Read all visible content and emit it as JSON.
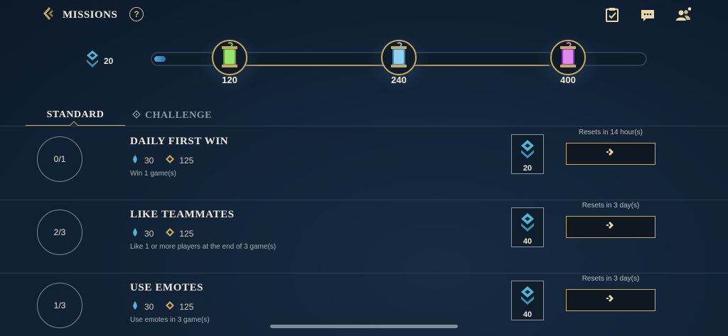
{
  "header": {
    "title": "MISSIONS",
    "help_label": "?",
    "icons": [
      "back-icon",
      "help-icon",
      "clipboard-check-icon",
      "chat-icon",
      "friends-icon"
    ]
  },
  "progress": {
    "current_points": "20",
    "fill_fraction": 0.02,
    "milestones": [
      {
        "label": "120",
        "icon": "green-capsule-icon"
      },
      {
        "label": "240",
        "icon": "blue-capsule-icon"
      },
      {
        "label": "400",
        "icon": "purple-capsule-icon"
      }
    ]
  },
  "tabs": [
    {
      "label": "STANDARD",
      "active": true
    },
    {
      "label": "CHALLENGE",
      "active": false
    }
  ],
  "missions": [
    {
      "progress": "0/1",
      "title": "DAILY FIRST WIN",
      "blue_reward": "30",
      "gold_reward": "125",
      "description": "Win 1 game(s)",
      "mission_points": "20",
      "reset": "Resets in 14 hour(s)"
    },
    {
      "progress": "2/3",
      "title": "LIKE TEAMMATES",
      "blue_reward": "30",
      "gold_reward": "125",
      "description": "Like 1 or more players at the end of 3 game(s)",
      "mission_points": "40",
      "reset": "Resets in 3 day(s)"
    },
    {
      "progress": "1/3",
      "title": "USE EMOTES",
      "blue_reward": "30",
      "gold_reward": "125",
      "description": "Use emotes in 3 game(s)",
      "mission_points": "40",
      "reset": "Resets in 3 day(s)"
    }
  ],
  "colors": {
    "gold_accent": "#c8a860",
    "blue_accent": "#4fb7d6",
    "background": "#13253a"
  }
}
